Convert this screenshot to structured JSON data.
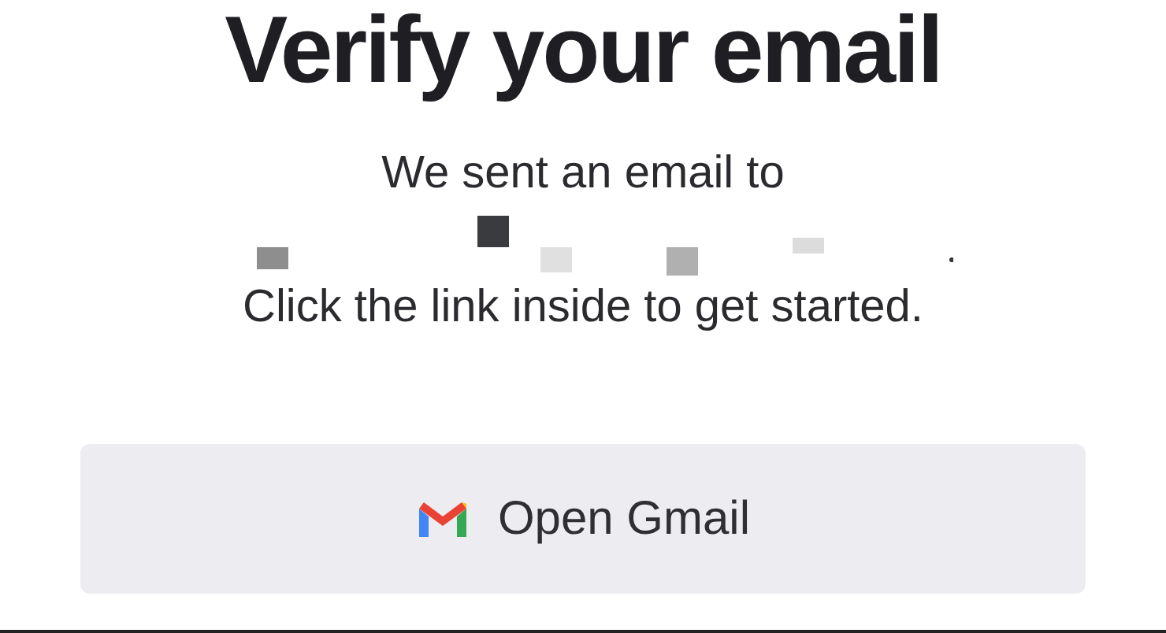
{
  "title": "Verify your email",
  "message_lines": [
    "We sent an email to",
    "Click the link inside to get started."
  ],
  "button": {
    "label": "Open Gmail"
  }
}
